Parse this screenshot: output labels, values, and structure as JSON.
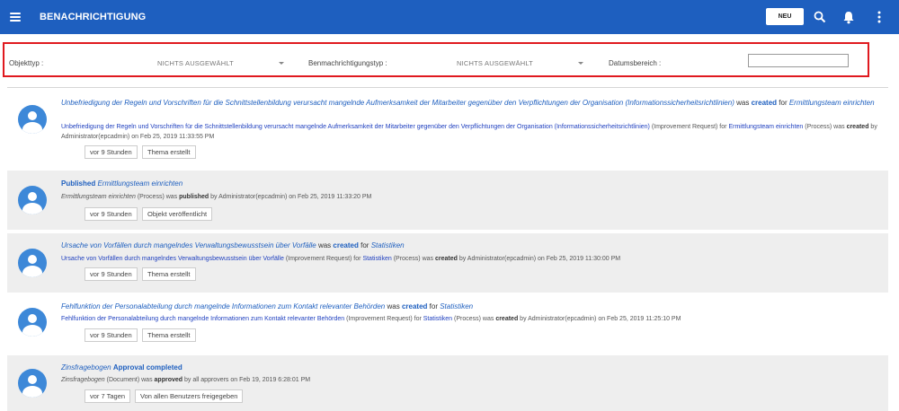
{
  "header": {
    "title": "BENACHRICHTIGUNG",
    "new_label": "NEU",
    "bg_color": "#1e5fbf"
  },
  "filters": {
    "object_type_label": "Objekttyp :",
    "object_type_value": "NICHTS AUSGEWÄHLT",
    "notification_type_label": "Benmachrichtigungstyp :",
    "notification_type_value": "NICHTS AUSGEWÄHLT",
    "date_range_label": "Datumsbereich :",
    "date_range_value": ""
  },
  "notifications": [
    {
      "title_link": "Unbefriedigung der Regeln und Vorschriften für die Schnittstellenbildung verursacht mangelnde Aufmerksamkeit der Mitarbeiter gegenüber den Verpflichtungen der Organisation (Informationssicherheitsrichtlinien)",
      "title_was": "was",
      "title_action": "created",
      "title_for": "for",
      "title_target": "Ermittlungsteam einrichten",
      "detail_link": "Unbefriedigung der Regeln und Vorschriften für die Schnittstellenbildung verursacht mangelnde Aufmerksamkeit der Mitarbeiter gegenüber den Verpflichtungen der Organisation (Informationssicherheitsrichtlinien)",
      "detail_type": "(Improvement Request) for",
      "detail_target": "Ermittlungsteam einrichten",
      "detail_target_type": "(Process) was",
      "detail_action": "created",
      "detail_by": "by Administrator(epcadmin) on Feb 25, 2019 11:33:55 PM",
      "time": "vor 9 Stunden",
      "tag": "Thema erstellt"
    },
    {
      "title_action": "Published",
      "title_target": "Ermittlungsteam einrichten",
      "detail_subject": "Ermittlungsteam einrichten",
      "detail_type": "(Process) was",
      "detail_action": "published",
      "detail_by": "by Administrator(epcadmin) on Feb 25, 2019 11:33:20 PM",
      "time": "vor 9 Stunden",
      "tag": "Objekt veröffentlicht"
    },
    {
      "title_link": "Ursache von Vorfällen durch mangelndes Verwaltungsbewusstsein über Vorfälle",
      "title_was": "was",
      "title_action": "created",
      "title_for": "for",
      "title_target": "Statistiken",
      "detail_link": "Ursache von Vorfällen durch mangelndes Verwaltungsbewusstsein über Vorfälle",
      "detail_type": "(Improvement Request) for",
      "detail_target": "Statistiken",
      "detail_target_type": "(Process) was",
      "detail_action": "created",
      "detail_by": "by Administrator(epcadmin) on Feb 25, 2019 11:30:00 PM",
      "time": "vor 9 Stunden",
      "tag": "Thema erstellt"
    },
    {
      "title_link": "Fehlfunktion der Personalabteilung durch mangelnde Informationen zum Kontakt relevanter Behörden",
      "title_was": "was",
      "title_action": "created",
      "title_for": "for",
      "title_target": "Statistiken",
      "detail_link": "Fehlfunktion der Personalabteilung durch mangelnde Informationen zum Kontakt relevanter Behörden",
      "detail_type": "(Improvement Request) for",
      "detail_target": "Statistiken",
      "detail_target_type": "(Process) was",
      "detail_action": "created",
      "detail_by": "by Administrator(epcadmin) on Feb 25, 2019 11:25:10 PM",
      "time": "vor 9 Stunden",
      "tag": "Thema erstellt"
    },
    {
      "title_link": "Zinsfragebogen",
      "title_action": "Approval completed",
      "detail_subject": "Zinsfragebogen",
      "detail_type": "(Document) was",
      "detail_action": "approved",
      "detail_by": "by all approvers on Feb 19, 2019 6:28:01 PM",
      "time": "vor 7 Tagen",
      "tag": "Von allen Benutzers freigegeben"
    }
  ]
}
